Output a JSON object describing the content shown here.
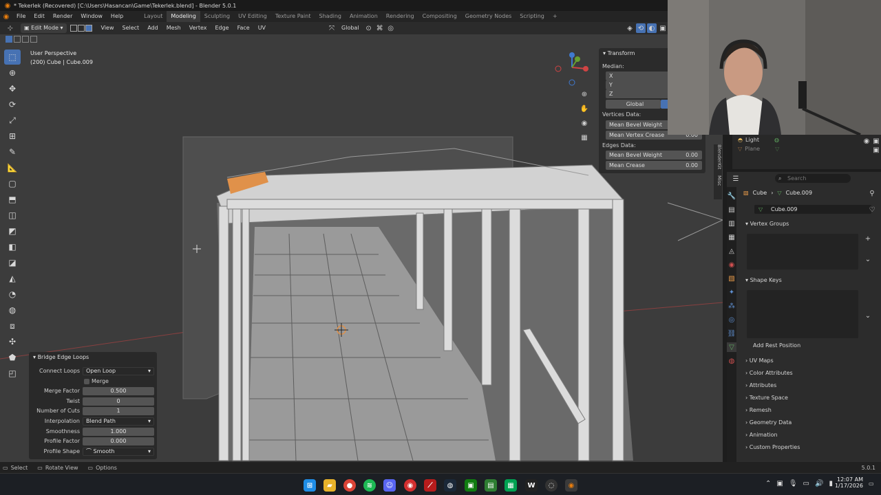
{
  "window": {
    "title": "* Tekerlek (Recovered) [C:\\Users\\Hasancan\\Game\\Tekerlek.blend] - Blender 5.0.1"
  },
  "menu": {
    "items": [
      "File",
      "Edit",
      "Render",
      "Window",
      "Help"
    ]
  },
  "workspaces": [
    "Layout",
    "Modeling",
    "Sculpting",
    "UV Editing",
    "Texture Paint",
    "Shading",
    "Animation",
    "Rendering",
    "Compositing",
    "Geometry Nodes",
    "Scripting"
  ],
  "header": {
    "mode": "Edit Mode",
    "menus": [
      "View",
      "Select",
      "Add",
      "Mesh",
      "Vertex",
      "Edge",
      "Face",
      "UV"
    ],
    "orientation": "Global"
  },
  "viewport": {
    "perspective": "User Perspective",
    "object_info": "(200) Cube | Cube.009"
  },
  "npanel": {
    "title": "Transform",
    "median_label": "Median:",
    "axes": [
      "X",
      "Y",
      "Z"
    ],
    "global_label": "Global",
    "vertices_header": "Vertices Data:",
    "vertices": [
      {
        "label": "Mean Bevel Weight",
        "value": ""
      },
      {
        "label": "Mean Vertex Crease",
        "value": "0.00"
      }
    ],
    "edges_header": "Edges Data:",
    "edges": [
      {
        "label": "Mean Bevel Weight",
        "value": "0.00"
      },
      {
        "label": "Mean Crease",
        "value": "0.00"
      }
    ],
    "side_tabs": [
      "BlenderKit",
      "Misc"
    ]
  },
  "bridge": {
    "title": "Bridge Edge Loops",
    "connect_loops": {
      "label": "Connect Loops",
      "value": "Open Loop"
    },
    "merge_label": "Merge",
    "merge_factor": {
      "label": "Merge Factor",
      "value": "0.500"
    },
    "twist": {
      "label": "Twist",
      "value": "0"
    },
    "cuts": {
      "label": "Number of Cuts",
      "value": "1"
    },
    "interpolation": {
      "label": "Interpolation",
      "value": "Blend Path"
    },
    "smoothness": {
      "label": "Smoothness",
      "value": "1.000"
    },
    "profile_factor": {
      "label": "Profile Factor",
      "value": "0.000"
    },
    "profile_shape": {
      "label": "Profile Shape",
      "value": "Smooth"
    }
  },
  "outliner": {
    "items": [
      "Light",
      "Plane"
    ]
  },
  "properties": {
    "search_placeholder": "Search",
    "breadcrumb": {
      "object": "Cube",
      "mesh": "Cube.009"
    },
    "mesh_name": "Cube.009",
    "vertex_groups": "Vertex Groups",
    "shape_keys": "Shape Keys",
    "add_rest_position": "Add Rest Position",
    "sections": [
      "UV Maps",
      "Color Attributes",
      "Attributes",
      "Texture Space",
      "Remesh",
      "Geometry Data",
      "Animation",
      "Custom Properties"
    ]
  },
  "statusbar": {
    "select": "Select",
    "rotate": "Rotate View",
    "options": "Options",
    "version": "5.0.1"
  },
  "taskbar": {
    "time": "12:07 AM",
    "date": "1/17/2026"
  }
}
